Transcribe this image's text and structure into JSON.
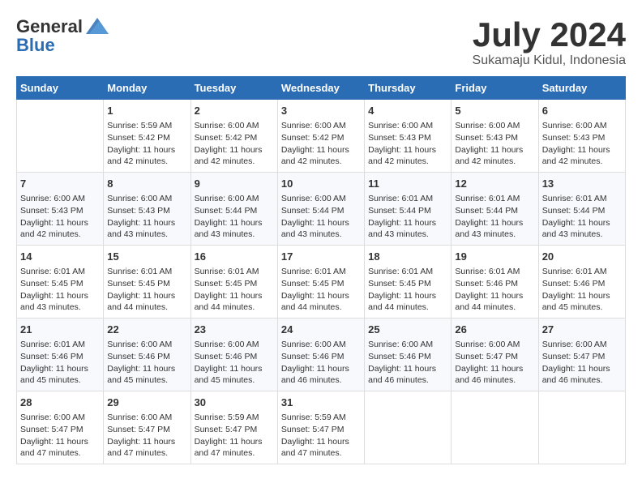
{
  "header": {
    "logo_line1": "General",
    "logo_line2": "Blue",
    "month": "July 2024",
    "location": "Sukamaju Kidul, Indonesia"
  },
  "weekdays": [
    "Sunday",
    "Monday",
    "Tuesday",
    "Wednesday",
    "Thursday",
    "Friday",
    "Saturday"
  ],
  "weeks": [
    [
      {
        "day": "",
        "info": ""
      },
      {
        "day": "1",
        "info": "Sunrise: 5:59 AM\nSunset: 5:42 PM\nDaylight: 11 hours\nand 42 minutes."
      },
      {
        "day": "2",
        "info": "Sunrise: 6:00 AM\nSunset: 5:42 PM\nDaylight: 11 hours\nand 42 minutes."
      },
      {
        "day": "3",
        "info": "Sunrise: 6:00 AM\nSunset: 5:42 PM\nDaylight: 11 hours\nand 42 minutes."
      },
      {
        "day": "4",
        "info": "Sunrise: 6:00 AM\nSunset: 5:43 PM\nDaylight: 11 hours\nand 42 minutes."
      },
      {
        "day": "5",
        "info": "Sunrise: 6:00 AM\nSunset: 5:43 PM\nDaylight: 11 hours\nand 42 minutes."
      },
      {
        "day": "6",
        "info": "Sunrise: 6:00 AM\nSunset: 5:43 PM\nDaylight: 11 hours\nand 42 minutes."
      }
    ],
    [
      {
        "day": "7",
        "info": "Sunrise: 6:00 AM\nSunset: 5:43 PM\nDaylight: 11 hours\nand 42 minutes."
      },
      {
        "day": "8",
        "info": "Sunrise: 6:00 AM\nSunset: 5:43 PM\nDaylight: 11 hours\nand 43 minutes."
      },
      {
        "day": "9",
        "info": "Sunrise: 6:00 AM\nSunset: 5:44 PM\nDaylight: 11 hours\nand 43 minutes."
      },
      {
        "day": "10",
        "info": "Sunrise: 6:00 AM\nSunset: 5:44 PM\nDaylight: 11 hours\nand 43 minutes."
      },
      {
        "day": "11",
        "info": "Sunrise: 6:01 AM\nSunset: 5:44 PM\nDaylight: 11 hours\nand 43 minutes."
      },
      {
        "day": "12",
        "info": "Sunrise: 6:01 AM\nSunset: 5:44 PM\nDaylight: 11 hours\nand 43 minutes."
      },
      {
        "day": "13",
        "info": "Sunrise: 6:01 AM\nSunset: 5:44 PM\nDaylight: 11 hours\nand 43 minutes."
      }
    ],
    [
      {
        "day": "14",
        "info": "Sunrise: 6:01 AM\nSunset: 5:45 PM\nDaylight: 11 hours\nand 43 minutes."
      },
      {
        "day": "15",
        "info": "Sunrise: 6:01 AM\nSunset: 5:45 PM\nDaylight: 11 hours\nand 44 minutes."
      },
      {
        "day": "16",
        "info": "Sunrise: 6:01 AM\nSunset: 5:45 PM\nDaylight: 11 hours\nand 44 minutes."
      },
      {
        "day": "17",
        "info": "Sunrise: 6:01 AM\nSunset: 5:45 PM\nDaylight: 11 hours\nand 44 minutes."
      },
      {
        "day": "18",
        "info": "Sunrise: 6:01 AM\nSunset: 5:45 PM\nDaylight: 11 hours\nand 44 minutes."
      },
      {
        "day": "19",
        "info": "Sunrise: 6:01 AM\nSunset: 5:46 PM\nDaylight: 11 hours\nand 44 minutes."
      },
      {
        "day": "20",
        "info": "Sunrise: 6:01 AM\nSunset: 5:46 PM\nDaylight: 11 hours\nand 45 minutes."
      }
    ],
    [
      {
        "day": "21",
        "info": "Sunrise: 6:01 AM\nSunset: 5:46 PM\nDaylight: 11 hours\nand 45 minutes."
      },
      {
        "day": "22",
        "info": "Sunrise: 6:00 AM\nSunset: 5:46 PM\nDaylight: 11 hours\nand 45 minutes."
      },
      {
        "day": "23",
        "info": "Sunrise: 6:00 AM\nSunset: 5:46 PM\nDaylight: 11 hours\nand 45 minutes."
      },
      {
        "day": "24",
        "info": "Sunrise: 6:00 AM\nSunset: 5:46 PM\nDaylight: 11 hours\nand 46 minutes."
      },
      {
        "day": "25",
        "info": "Sunrise: 6:00 AM\nSunset: 5:46 PM\nDaylight: 11 hours\nand 46 minutes."
      },
      {
        "day": "26",
        "info": "Sunrise: 6:00 AM\nSunset: 5:47 PM\nDaylight: 11 hours\nand 46 minutes."
      },
      {
        "day": "27",
        "info": "Sunrise: 6:00 AM\nSunset: 5:47 PM\nDaylight: 11 hours\nand 46 minutes."
      }
    ],
    [
      {
        "day": "28",
        "info": "Sunrise: 6:00 AM\nSunset: 5:47 PM\nDaylight: 11 hours\nand 47 minutes."
      },
      {
        "day": "29",
        "info": "Sunrise: 6:00 AM\nSunset: 5:47 PM\nDaylight: 11 hours\nand 47 minutes."
      },
      {
        "day": "30",
        "info": "Sunrise: 5:59 AM\nSunset: 5:47 PM\nDaylight: 11 hours\nand 47 minutes."
      },
      {
        "day": "31",
        "info": "Sunrise: 5:59 AM\nSunset: 5:47 PM\nDaylight: 11 hours\nand 47 minutes."
      },
      {
        "day": "",
        "info": ""
      },
      {
        "day": "",
        "info": ""
      },
      {
        "day": "",
        "info": ""
      }
    ]
  ]
}
